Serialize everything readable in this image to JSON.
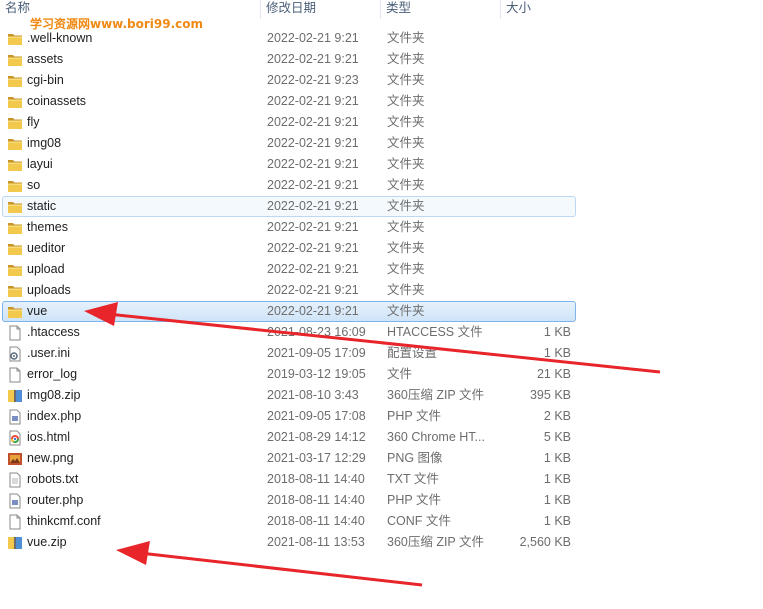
{
  "header": {
    "name": "名称",
    "date": "修改日期",
    "type": "类型",
    "size": "大小"
  },
  "watermark": "学习资源网www.bori99.com",
  "files": [
    {
      "name": ".well-known",
      "date": "2022-02-21 9:21",
      "type": "文件夹",
      "size": "",
      "icon": "folder-icon",
      "state": ""
    },
    {
      "name": "assets",
      "date": "2022-02-21 9:21",
      "type": "文件夹",
      "size": "",
      "icon": "folder-icon",
      "state": ""
    },
    {
      "name": "cgi-bin",
      "date": "2022-02-21 9:23",
      "type": "文件夹",
      "size": "",
      "icon": "folder-icon",
      "state": ""
    },
    {
      "name": "coinassets",
      "date": "2022-02-21 9:21",
      "type": "文件夹",
      "size": "",
      "icon": "folder-icon",
      "state": ""
    },
    {
      "name": "fly",
      "date": "2022-02-21 9:21",
      "type": "文件夹",
      "size": "",
      "icon": "folder-icon",
      "state": ""
    },
    {
      "name": "img08",
      "date": "2022-02-21 9:21",
      "type": "文件夹",
      "size": "",
      "icon": "folder-icon",
      "state": ""
    },
    {
      "name": "layui",
      "date": "2022-02-21 9:21",
      "type": "文件夹",
      "size": "",
      "icon": "folder-icon",
      "state": ""
    },
    {
      "name": "so",
      "date": "2022-02-21 9:21",
      "type": "文件夹",
      "size": "",
      "icon": "folder-icon",
      "state": ""
    },
    {
      "name": "static",
      "date": "2022-02-21 9:21",
      "type": "文件夹",
      "size": "",
      "icon": "folder-icon",
      "state": "hover"
    },
    {
      "name": "themes",
      "date": "2022-02-21 9:21",
      "type": "文件夹",
      "size": "",
      "icon": "folder-icon",
      "state": ""
    },
    {
      "name": "ueditor",
      "date": "2022-02-21 9:21",
      "type": "文件夹",
      "size": "",
      "icon": "folder-icon",
      "state": ""
    },
    {
      "name": "upload",
      "date": "2022-02-21 9:21",
      "type": "文件夹",
      "size": "",
      "icon": "folder-icon",
      "state": ""
    },
    {
      "name": "uploads",
      "date": "2022-02-21 9:21",
      "type": "文件夹",
      "size": "",
      "icon": "folder-icon",
      "state": ""
    },
    {
      "name": "vue",
      "date": "2022-02-21 9:21",
      "type": "文件夹",
      "size": "",
      "icon": "folder-icon",
      "state": "selected"
    },
    {
      "name": ".htaccess",
      "date": "2021-08-23 16:09",
      "type": "HTACCESS 文件",
      "size": "1 KB",
      "icon": "file-icon",
      "state": ""
    },
    {
      "name": ".user.ini",
      "date": "2021-09-05 17:09",
      "type": "配置设置",
      "size": "1 KB",
      "icon": "settings-file-icon",
      "state": ""
    },
    {
      "name": "error_log",
      "date": "2019-03-12 19:05",
      "type": "文件",
      "size": "21 KB",
      "icon": "file-icon",
      "state": ""
    },
    {
      "name": "img08.zip",
      "date": "2021-08-10 3:43",
      "type": "360压缩 ZIP 文件",
      "size": "395 KB",
      "icon": "zip-icon",
      "state": ""
    },
    {
      "name": "index.php",
      "date": "2021-09-05 17:08",
      "type": "PHP 文件",
      "size": "2 KB",
      "icon": "php-file-icon",
      "state": ""
    },
    {
      "name": "ios.html",
      "date": "2021-08-29 14:12",
      "type": "360 Chrome HT...",
      "size": "5 KB",
      "icon": "chrome-html-icon",
      "state": ""
    },
    {
      "name": "new.png",
      "date": "2021-03-17 12:29",
      "type": "PNG 图像",
      "size": "1 KB",
      "icon": "image-file-icon",
      "state": ""
    },
    {
      "name": "robots.txt",
      "date": "2018-08-11 14:40",
      "type": "TXT 文件",
      "size": "1 KB",
      "icon": "text-file-icon",
      "state": ""
    },
    {
      "name": "router.php",
      "date": "2018-08-11 14:40",
      "type": "PHP 文件",
      "size": "1 KB",
      "icon": "php-file-icon",
      "state": ""
    },
    {
      "name": "thinkcmf.conf",
      "date": "2018-08-11 14:40",
      "type": "CONF 文件",
      "size": "1 KB",
      "icon": "file-icon",
      "state": ""
    },
    {
      "name": "vue.zip",
      "date": "2021-08-11 13:53",
      "type": "360压缩 ZIP 文件",
      "size": "2,560 KB",
      "icon": "zip-icon",
      "state": ""
    }
  ],
  "colors": {
    "folder": "#e8b838",
    "folder_dark": "#c9942a",
    "arrow": "#e8252b",
    "watermark": "#f08a14",
    "selection_border": "#7eb4ea"
  }
}
